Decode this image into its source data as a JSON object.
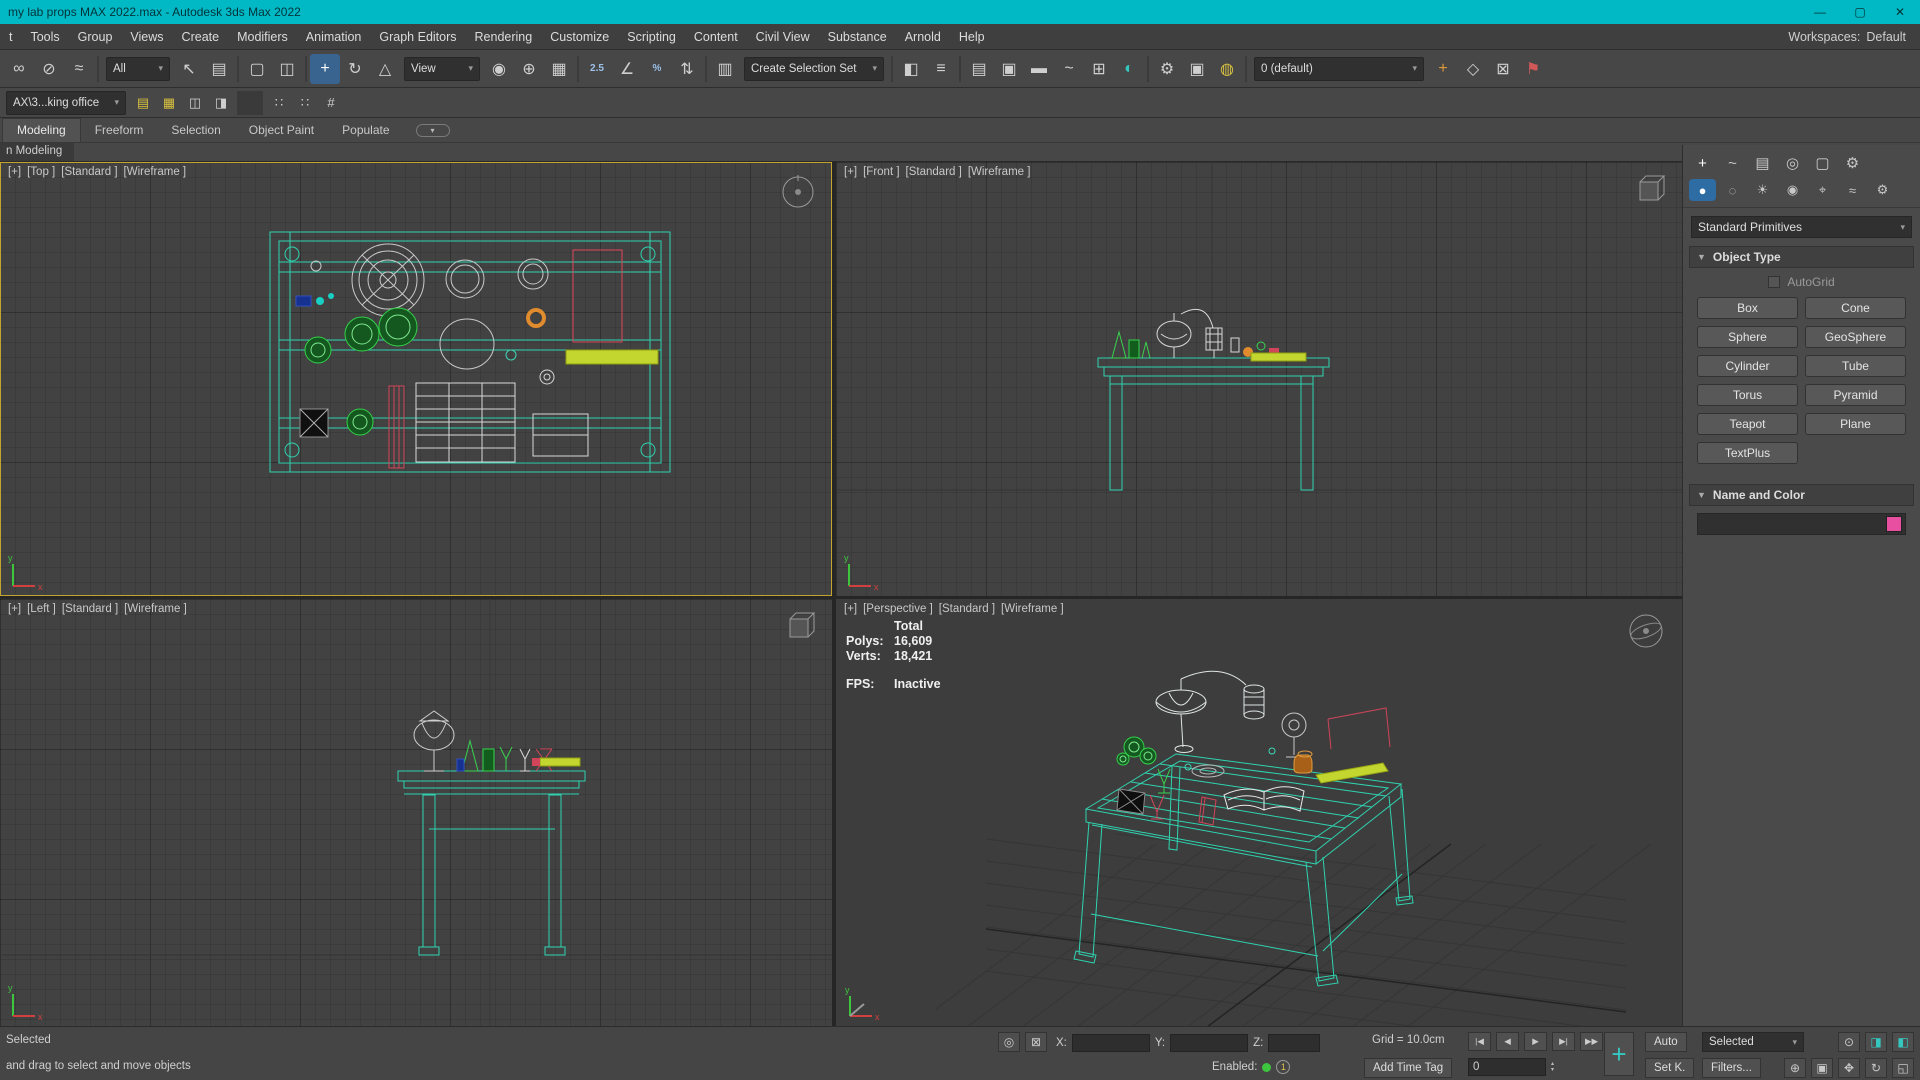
{
  "titlebar": {
    "title": "my lab props MAX 2022.max - Autodesk 3ds Max 2022",
    "minimize": "—",
    "restore": "▢",
    "close": "✕"
  },
  "menubar": {
    "items": [
      {
        "label": "t",
        "name": "menu-item-truncated"
      },
      {
        "label": "Tools",
        "name": "menu-tools"
      },
      {
        "label": "Group",
        "name": "menu-group"
      },
      {
        "label": "Views",
        "name": "menu-views"
      },
      {
        "label": "Create",
        "name": "menu-create"
      },
      {
        "label": "Modifiers",
        "name": "menu-modifiers"
      },
      {
        "label": "Animation",
        "name": "menu-animation"
      },
      {
        "label": "Graph Editors",
        "name": "menu-graph-editors"
      },
      {
        "label": "Rendering",
        "name": "menu-rendering"
      },
      {
        "label": "Customize",
        "name": "menu-customize"
      },
      {
        "label": "Scripting",
        "name": "menu-scripting"
      },
      {
        "label": "Content",
        "name": "menu-content"
      },
      {
        "label": "Civil View",
        "name": "menu-civil-view"
      },
      {
        "label": "Substance",
        "name": "menu-substance"
      },
      {
        "label": "Arnold",
        "name": "menu-arnold"
      },
      {
        "label": "Help",
        "name": "menu-help"
      }
    ],
    "workspaces_label": "Workspaces:",
    "workspaces_value": "Default"
  },
  "toolbar": {
    "seg1": [
      {
        "name": "select-and-link-icon",
        "glyph": "∞"
      },
      {
        "name": "unlink-selection-icon",
        "glyph": "⊘"
      },
      {
        "name": "bind-to-spacewarp-icon",
        "glyph": "≈"
      },
      {
        "name": "toolbar-separator",
        "glyph": "",
        "cls": "sep"
      }
    ],
    "filter_dropdown": "All",
    "seg2": [
      {
        "name": "select-object-icon",
        "glyph": "↖"
      },
      {
        "name": "select-by-name-icon",
        "glyph": "▤"
      },
      {
        "name": "toolbar-separator",
        "glyph": "",
        "cls": "sep"
      },
      {
        "name": "rect-selection-icon",
        "glyph": "▢"
      },
      {
        "name": "window-crossing-icon",
        "glyph": "◫"
      },
      {
        "name": "toolbar-separator",
        "glyph": "",
        "cls": "sep"
      },
      {
        "name": "select-move-icon",
        "glyph": "+",
        "cls": "active"
      },
      {
        "name": "select-rotate-icon",
        "glyph": "↻"
      },
      {
        "name": "select-scale-icon",
        "glyph": "△"
      }
    ],
    "coordsys_dropdown": "View",
    "seg3": [
      {
        "name": "use-pivot-center-icon",
        "glyph": "◉"
      },
      {
        "name": "select-manipulate-icon",
        "glyph": "⊕"
      },
      {
        "name": "keyboard-override-icon",
        "glyph": "▦"
      },
      {
        "name": "toolbar-separator",
        "glyph": "",
        "cls": "sep"
      },
      {
        "name": "snap-toggle-icon",
        "glyph": "2.5",
        "cls": "txt"
      },
      {
        "name": "angle-snap-icon",
        "glyph": "∠"
      },
      {
        "name": "percent-snap-icon",
        "glyph": "%",
        "cls": "txt"
      },
      {
        "name": "spinner-snap-icon",
        "glyph": "⇅"
      },
      {
        "name": "toolbar-separator",
        "glyph": "",
        "cls": "sep"
      },
      {
        "name": "named-selection-sets-icon",
        "glyph": "▥"
      }
    ],
    "selection_set_dropdown": "Create Selection Set",
    "seg4": [
      {
        "name": "toolbar-separator",
        "glyph": "",
        "cls": "sep"
      },
      {
        "name": "mirror-icon",
        "glyph": "◧"
      },
      {
        "name": "align-icon",
        "glyph": "≡"
      },
      {
        "name": "toolbar-separator",
        "glyph": "",
        "cls": "sep"
      },
      {
        "name": "scene-explorer-icon",
        "glyph": "▤"
      },
      {
        "name": "layer-explorer-icon",
        "glyph": "▣"
      },
      {
        "name": "ribbon-toggle-icon",
        "glyph": "▬"
      },
      {
        "name": "curve-editor-icon",
        "glyph": "~"
      },
      {
        "name": "schematic-view-icon",
        "glyph": "⊞"
      },
      {
        "name": "material-editor-icon",
        "glyph": "◐",
        "cls": "teal"
      },
      {
        "name": "toolbar-separator",
        "glyph": "",
        "cls": "sep"
      },
      {
        "name": "render-setup-icon",
        "glyph": "⚙"
      },
      {
        "name": "rendered-frame-icon",
        "glyph": "▣"
      },
      {
        "name": "render-production-icon",
        "glyph": "◍",
        "cls": "yellow"
      },
      {
        "name": "toolbar-separator",
        "glyph": "",
        "cls": "sep"
      }
    ],
    "preset_dropdown": "0 (default)",
    "seg5": [
      {
        "name": "add-to-scene-icon",
        "glyph": "+",
        "cls": "orange"
      },
      {
        "name": "isolate-toggle-icon",
        "glyph": "◇"
      },
      {
        "name": "lock-selection-icon",
        "glyph": "⊠"
      },
      {
        "name": "flag-icon",
        "glyph": "⚑",
        "cls": "red"
      }
    ]
  },
  "toolbar2": {
    "project_dropdown": "AX\\3...king office",
    "icons": [
      {
        "name": "save-scene-icon",
        "glyph": "▤",
        "cls": "yellow"
      },
      {
        "name": "open-scene-icon",
        "glyph": "▦",
        "cls": "yellow"
      },
      {
        "name": "fetch-icon",
        "glyph": "◫"
      },
      {
        "name": "hold-icon",
        "glyph": "◨"
      },
      {
        "name": "toolbar-separator",
        "glyph": "",
        "cls": "sep"
      },
      {
        "name": "grid-points-icon",
        "glyph": "∷"
      },
      {
        "name": "dot-grid-icon",
        "glyph": "∷"
      },
      {
        "name": "snaps-grid-icon",
        "glyph": "#"
      }
    ]
  },
  "ribbon": {
    "tabs": [
      {
        "label": "Modeling",
        "name": "ribbon-tab-modeling",
        "cls": "active"
      },
      {
        "label": "Freeform",
        "name": "ribbon-tab-freeform"
      },
      {
        "label": "Selection",
        "name": "ribbon-tab-selection"
      },
      {
        "label": "Object Paint",
        "name": "ribbon-tab-object-paint"
      },
      {
        "label": "Populate",
        "name": "ribbon-tab-populate"
      }
    ],
    "more_glyph": "▾",
    "subtab": "n Modeling"
  },
  "viewports": {
    "top": {
      "plus": "[+]",
      "name": "[Top ]",
      "shading": "[Standard ]",
      "style": "[Wireframe ]"
    },
    "front": {
      "plus": "[+]",
      "name": "[Front ]",
      "shading": "[Standard ]",
      "style": "[Wireframe ]"
    },
    "left": {
      "plus": "[+]",
      "name": "[Left ]",
      "shading": "[Standard ]",
      "style": "[Wireframe ]"
    },
    "perspective": {
      "plus": "[+]",
      "name": "[Perspective ]",
      "shading": "[Standard ]",
      "style": "[Wireframe ]"
    },
    "stats": {
      "total": "Total",
      "polys_label": "Polys:",
      "polys": "16,609",
      "verts_label": "Verts:",
      "verts": "18,421",
      "fps_label": "FPS:",
      "fps": "Inactive"
    }
  },
  "command_panel": {
    "tabs": [
      {
        "name": "create-tab-icon",
        "glyph": "+",
        "cls": "active"
      },
      {
        "name": "modify-tab-icon",
        "glyph": "~"
      },
      {
        "name": "hierarchy-tab-icon",
        "glyph": "▤"
      },
      {
        "name": "motion-tab-icon",
        "glyph": "◎"
      },
      {
        "name": "display-tab-icon",
        "glyph": "▢"
      },
      {
        "name": "utilities-tab-icon",
        "glyph": "⚙"
      }
    ],
    "categories": [
      {
        "name": "geometry-category-icon",
        "glyph": "●",
        "cls": "active"
      },
      {
        "name": "shapes-category-icon",
        "glyph": "◌"
      },
      {
        "name": "lights-category-icon",
        "glyph": "☀"
      },
      {
        "name": "cameras-category-icon",
        "glyph": "◉"
      },
      {
        "name": "helpers-category-icon",
        "glyph": "⌖"
      },
      {
        "name": "spacewarps-category-icon",
        "glyph": "≈"
      },
      {
        "name": "systems-category-icon",
        "glyph": "⚙"
      }
    ],
    "subcategory_dropdown": "Standard Primitives",
    "object_type": {
      "title": "Object Type",
      "autogrid": "AutoGrid",
      "buttons": [
        {
          "label": "Box",
          "name": "box-button"
        },
        {
          "label": "Cone",
          "name": "cone-button"
        },
        {
          "label": "Sphere",
          "name": "sphere-button"
        },
        {
          "label": "GeoSphere",
          "name": "geosphere-button"
        },
        {
          "label": "Cylinder",
          "name": "cylinder-button"
        },
        {
          "label": "Tube",
          "name": "tube-button"
        },
        {
          "label": "Torus",
          "name": "torus-button"
        },
        {
          "label": "Pyramid",
          "name": "pyramid-button"
        },
        {
          "label": "Teapot",
          "name": "teapot-button"
        },
        {
          "label": "Plane",
          "name": "plane-button"
        },
        {
          "label": "TextPlus",
          "name": "textplus-button"
        }
      ]
    },
    "name_color": {
      "title": "Name and Color"
    }
  },
  "statusbar": {
    "selected_text": "Selected",
    "prompt_text": "and drag to select and move objects",
    "isolate_glyph": "◎",
    "lock_glyph": "⊠",
    "x_label": "X:",
    "y_label": "Y:",
    "z_label": "Z:",
    "grid_text": "Grid = 10.0cm",
    "playback": [
      {
        "name": "go-start-button",
        "glyph": "|◀"
      },
      {
        "name": "prev-frame-button",
        "glyph": "◀"
      },
      {
        "name": "play-button",
        "glyph": "▶"
      },
      {
        "name": "next-frame-button",
        "glyph": "▶|"
      },
      {
        "name": "go-end-button",
        "glyph": "▶▶"
      }
    ],
    "set_key_plus": "+",
    "auto_button": "Auto",
    "selected_dropdown": "Selected",
    "set_key_button": "Set K.",
    "filters_button": "Filters...",
    "enabled_label": "Enabled:",
    "enabled_badge": "1",
    "add_time_tag": "Add Time Tag",
    "frame_value": "0",
    "right_icons_row1": [
      {
        "name": "scene-search-icon",
        "glyph": "⊙"
      },
      {
        "name": "viewport-cube-icon",
        "glyph": "◨",
        "cls": "teal"
      },
      {
        "name": "viewport-layout-icon",
        "glyph": "◧",
        "cls": "teal"
      }
    ],
    "right_icons_row2": [
      {
        "name": "zoom-icon",
        "glyph": "⊕"
      },
      {
        "name": "zoom-extents-icon",
        "glyph": "▣"
      },
      {
        "name": "pan-icon",
        "glyph": "✥"
      },
      {
        "name": "orbit-icon",
        "glyph": "↻"
      },
      {
        "name": "maximize-viewport-icon",
        "glyph": "◱"
      }
    ]
  }
}
